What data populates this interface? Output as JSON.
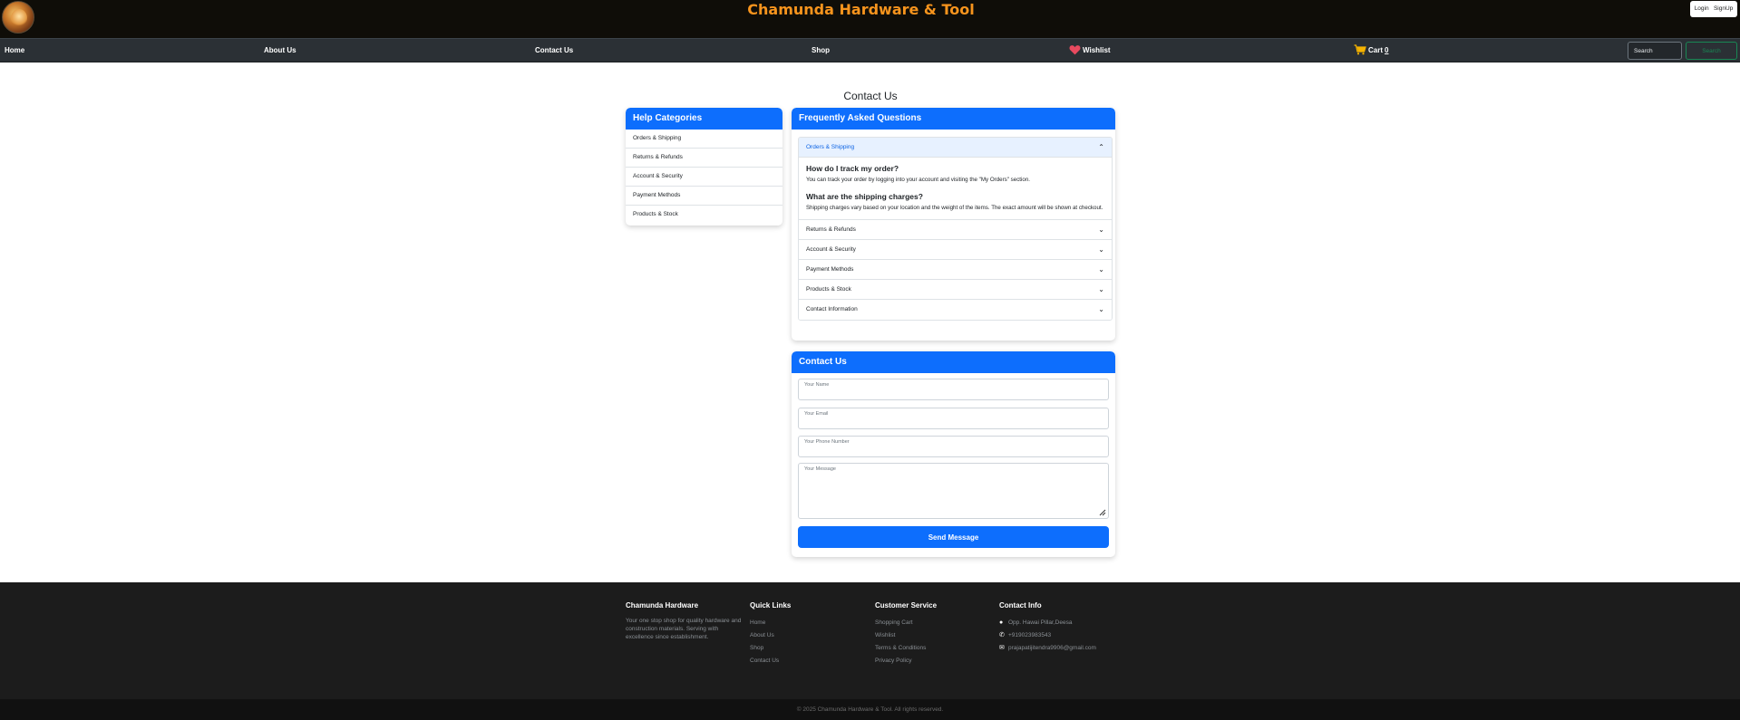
{
  "brand": {
    "title": "Chamunda Hardware & Tool"
  },
  "auth": {
    "login": "Login",
    "signup": "SignUp"
  },
  "nav": {
    "home": "Home",
    "about": "About Us",
    "contact": "Contact Us",
    "shop": "Shop",
    "wishlist": "Wishlist",
    "cart": "Cart",
    "cart_count": "0",
    "search_placeholder": "Search",
    "search_button": "Search"
  },
  "main": {
    "title": "Contact Us",
    "help": {
      "heading": "Help Categories",
      "items": [
        "Orders & Shipping",
        "Returns & Refunds",
        "Account & Security",
        "Payment Methods",
        "Products & Stock"
      ]
    },
    "faq": {
      "heading": "Frequently Asked Questions",
      "open_section": "Orders & Shipping",
      "qa": [
        {
          "q": "How do I track my order?",
          "a": "You can track your order by logging into your account and visiting the \"My Orders\" section."
        },
        {
          "q": "What are the shipping charges?",
          "a": "Shipping charges vary based on your location and the weight of the items. The exact amount will be shown at checkout."
        }
      ],
      "collapsed": [
        "Returns & Refunds",
        "Account & Security",
        "Payment Methods",
        "Products & Stock",
        "Contact Information"
      ]
    },
    "contact_form": {
      "heading": "Contact Us",
      "name_label": "Your Name",
      "email_label": "Your Email",
      "phone_label": "Your Phone Number",
      "message_label": "Your Message",
      "submit": "Send Message"
    }
  },
  "footer": {
    "about": {
      "heading": "Chamunda Hardware",
      "text": "Your one stop shop for quality hardware and construction materials. Serving with excellence since establishment."
    },
    "quick_links": {
      "heading": "Quick Links",
      "items": [
        "Home",
        "About Us",
        "Shop",
        "Contact Us"
      ]
    },
    "customer_service": {
      "heading": "Customer Service",
      "items": [
        "Shopping Cart",
        "Wishlist",
        "Terms & Conditions",
        "Privacy Policy"
      ]
    },
    "contact_info": {
      "heading": "Contact Info",
      "address": "Opp. Hawai Pillar,Deesa",
      "phone": "+919023983543",
      "email": "prajapatijitendra9906@gmail.com"
    },
    "copyright": "© 2025 Chamunda Hardware & Tool. All rights reserved."
  },
  "colors": {
    "accent": "#0d6efd",
    "brand": "#f7941d",
    "header_bg": "#0f0d08",
    "nav_bg": "#2b3035",
    "footer_bg": "#1c1c1c",
    "search_outline": "#198754"
  }
}
